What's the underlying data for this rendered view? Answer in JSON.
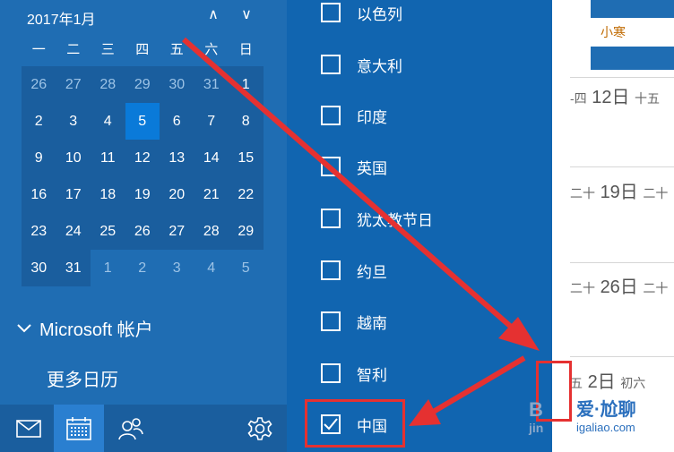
{
  "calendar": {
    "month_label": "2017年1月",
    "nav_up": "∧",
    "nav_down": "∨",
    "weekdays": [
      "一",
      "二",
      "三",
      "四",
      "五",
      "六",
      "日"
    ],
    "weeks": [
      [
        "26",
        "27",
        "28",
        "29",
        "30",
        "31",
        "1"
      ],
      [
        "2",
        "3",
        "4",
        "5",
        "6",
        "7",
        "8"
      ],
      [
        "9",
        "10",
        "11",
        "12",
        "13",
        "14",
        "15"
      ],
      [
        "16",
        "17",
        "18",
        "19",
        "20",
        "21",
        "22"
      ],
      [
        "23",
        "24",
        "25",
        "26",
        "27",
        "28",
        "29"
      ],
      [
        "30",
        "31",
        "1",
        "2",
        "3",
        "4",
        "5"
      ]
    ],
    "today": "5"
  },
  "sidebar": {
    "account_label": "Microsoft 帐户",
    "more_calendars_label": "更多日历"
  },
  "bottom_bar": {
    "icons": [
      "mail-icon",
      "calendar-icon",
      "people-icon",
      "settings-icon"
    ]
  },
  "holiday_calendars": [
    {
      "label": "以色列",
      "checked": false
    },
    {
      "label": "意大利",
      "checked": false
    },
    {
      "label": "印度",
      "checked": false
    },
    {
      "label": "英国",
      "checked": false
    },
    {
      "label": "犹太教节日",
      "checked": false
    },
    {
      "label": "约旦",
      "checked": false
    },
    {
      "label": "越南",
      "checked": false
    },
    {
      "label": "智利",
      "checked": false
    },
    {
      "label": "中国",
      "checked": true
    }
  ],
  "calendar_view": {
    "event_top": "小寒",
    "rows": [
      {
        "prefix": "-四",
        "date": "12日",
        "lunar": "十五"
      },
      {
        "prefix": "二十",
        "date": "19日",
        "lunar": "二十"
      },
      {
        "prefix": "二十",
        "date": "26日",
        "lunar": "二十"
      },
      {
        "prefix": "五",
        "date": "2日",
        "lunar": "初六"
      }
    ]
  },
  "watermark": {
    "brand": "爱·尬聊",
    "url": "igaliao.com",
    "ji": "jin"
  },
  "colors": {
    "sidebar_bg": "#1f6db3",
    "panel_bg": "#1165b0",
    "today_bg": "#0a7ad9",
    "arrow": "#e53131"
  }
}
